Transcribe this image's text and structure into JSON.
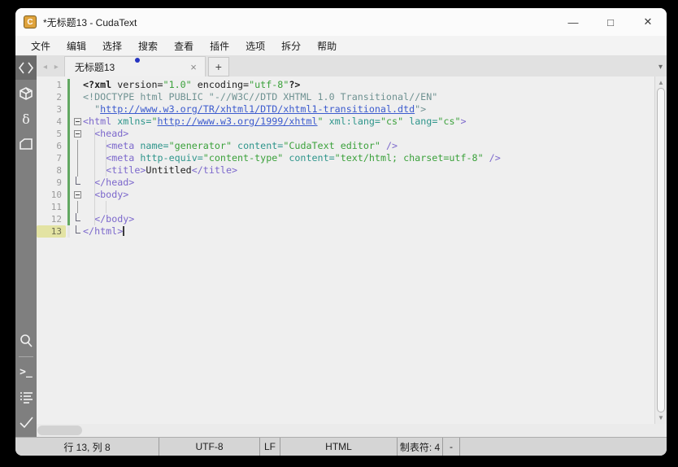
{
  "titlebar": {
    "title": "*无标题13 - CudaText",
    "app_initial": "C",
    "minimize": "—",
    "maximize": "□",
    "close": "✕"
  },
  "menu": {
    "items": [
      "文件",
      "编辑",
      "选择",
      "搜索",
      "查看",
      "插件",
      "选项",
      "拆分",
      "帮助"
    ]
  },
  "tabbar": {
    "scroll_arrows": "◂ ▸",
    "active_tab": "无标题13",
    "close": "×",
    "new_tab": "+",
    "overflow": "▾"
  },
  "sidebar": {
    "icons": [
      {
        "name": "code-tree-icon",
        "glyph": "code",
        "active": true,
        "group": "top"
      },
      {
        "name": "package-icon",
        "glyph": "cube",
        "group": "top"
      },
      {
        "name": "snippets-delta-icon",
        "glyph": "delta",
        "group": "top"
      },
      {
        "name": "file-panel-icon",
        "glyph": "file",
        "group": "top"
      },
      {
        "name": "search-icon",
        "glyph": "magnifier",
        "group": "bottom"
      },
      {
        "name": "console-icon",
        "glyph": "console",
        "group": "bottom",
        "divider_before": true
      },
      {
        "name": "output-list-icon",
        "glyph": "list",
        "group": "bottom"
      },
      {
        "name": "validate-check-icon",
        "glyph": "check",
        "group": "bottom"
      }
    ]
  },
  "editor": {
    "lines": [
      {
        "n": 1,
        "fold": "",
        "mod": true,
        "seg": [
          [
            "pi",
            "<?xml"
          ],
          [
            "pl",
            " version="
          ],
          [
            "str",
            "\"1.0\""
          ],
          [
            "pl",
            " encoding="
          ],
          [
            "str",
            "\"utf-8\""
          ],
          [
            "pi",
            "?>"
          ]
        ]
      },
      {
        "n": 2,
        "fold": "",
        "mod": true,
        "seg": [
          [
            "doc",
            "<!DOCTYPE html PUBLIC \"-//W3C//DTD XHTML 1.0 Transitional//EN\""
          ]
        ]
      },
      {
        "n": 3,
        "fold": "",
        "mod": true,
        "seg": [
          [
            "doc",
            "  \""
          ],
          [
            "url",
            "http://www.w3.org/TR/xhtml1/DTD/xhtml1-transitional.dtd"
          ],
          [
            "doc",
            "\">"
          ]
        ]
      },
      {
        "n": 4,
        "fold": "box",
        "mod": true,
        "seg": [
          [
            "tag",
            "<html"
          ],
          [
            "pl",
            " "
          ],
          [
            "attr",
            "xmlns="
          ],
          [
            "str",
            "\""
          ],
          [
            "url",
            "http://www.w3.org/1999/xhtml"
          ],
          [
            "str",
            "\""
          ],
          [
            "pl",
            " "
          ],
          [
            "attr",
            "xml:lang="
          ],
          [
            "str",
            "\"cs\""
          ],
          [
            "pl",
            " "
          ],
          [
            "attr",
            "lang="
          ],
          [
            "str",
            "\"cs\""
          ],
          [
            "tag",
            ">"
          ]
        ]
      },
      {
        "n": 5,
        "fold": "box",
        "mod": true,
        "seg": [
          [
            "pl",
            "  "
          ],
          [
            "tag",
            "<head>"
          ]
        ]
      },
      {
        "n": 6,
        "fold": "line",
        "mod": true,
        "seg": [
          [
            "pl",
            "    "
          ],
          [
            "tag",
            "<meta"
          ],
          [
            "pl",
            " "
          ],
          [
            "attr",
            "name="
          ],
          [
            "str",
            "\"generator\""
          ],
          [
            "pl",
            " "
          ],
          [
            "attr",
            "content="
          ],
          [
            "str",
            "\"CudaText editor\""
          ],
          [
            "pl",
            " "
          ],
          [
            "tag",
            "/>"
          ]
        ]
      },
      {
        "n": 7,
        "fold": "line",
        "mod": true,
        "seg": [
          [
            "pl",
            "    "
          ],
          [
            "tag",
            "<meta"
          ],
          [
            "pl",
            " "
          ],
          [
            "attr",
            "http-equiv="
          ],
          [
            "str",
            "\"content-type\""
          ],
          [
            "pl",
            " "
          ],
          [
            "attr",
            "content="
          ],
          [
            "str",
            "\"text/html; charset=utf-8\""
          ],
          [
            "pl",
            " "
          ],
          [
            "tag",
            "/>"
          ]
        ]
      },
      {
        "n": 8,
        "fold": "line",
        "mod": true,
        "seg": [
          [
            "pl",
            "    "
          ],
          [
            "tag",
            "<title>"
          ],
          [
            "pl",
            "Untitled"
          ],
          [
            "tag",
            "</title>"
          ]
        ]
      },
      {
        "n": 9,
        "fold": "end",
        "mod": true,
        "seg": [
          [
            "pl",
            "  "
          ],
          [
            "tag",
            "</head>"
          ]
        ]
      },
      {
        "n": 10,
        "fold": "box",
        "mod": true,
        "seg": [
          [
            "pl",
            "  "
          ],
          [
            "tag",
            "<body>"
          ]
        ]
      },
      {
        "n": 11,
        "fold": "line",
        "mod": true,
        "seg": []
      },
      {
        "n": 12,
        "fold": "end",
        "mod": true,
        "seg": [
          [
            "pl",
            "  "
          ],
          [
            "tag",
            "</body>"
          ]
        ]
      },
      {
        "n": 13,
        "fold": "end",
        "mod": false,
        "current": true,
        "caret": true,
        "seg": [
          [
            "tag",
            "</html>"
          ]
        ]
      }
    ]
  },
  "statusbar": {
    "cells": [
      "行 13, 列 8",
      "UTF-8",
      "LF",
      "HTML",
      "制表符: 4",
      "-",
      ""
    ]
  }
}
